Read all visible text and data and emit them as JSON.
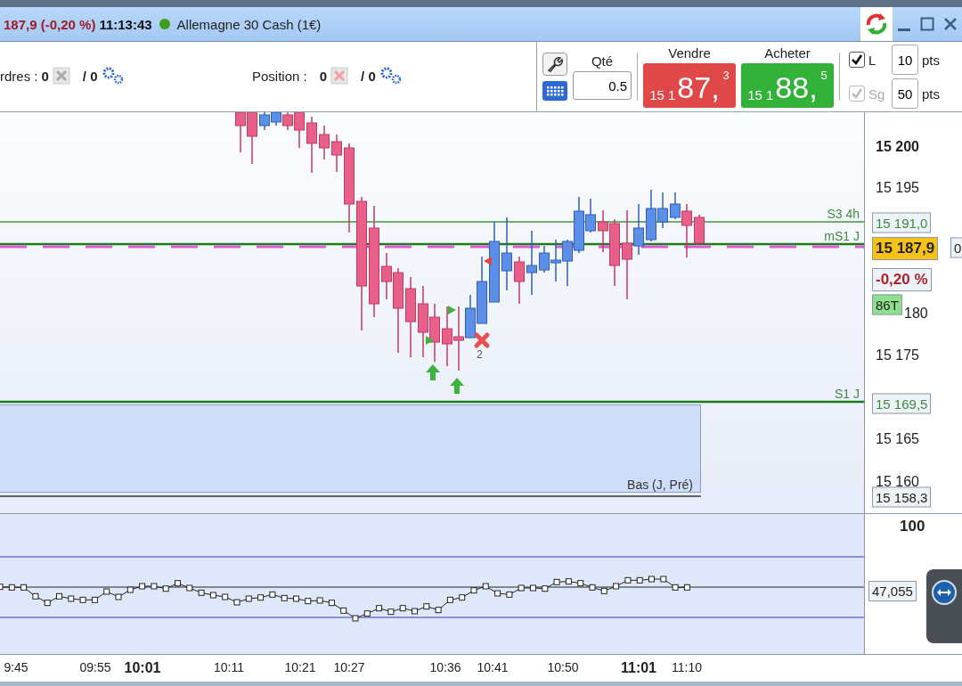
{
  "title_bar": {
    "price": "187,9 (-0,20 %)",
    "time": "11:13:43",
    "connected": true,
    "instrument": "Allemagne 30 Cash (1€)"
  },
  "toolbar": {
    "orders": {
      "label": "rdres :",
      "count": "0",
      "total": "/ 0"
    },
    "position": {
      "label": "Position :",
      "count": "0",
      "total": "/ 0"
    },
    "quantity": {
      "label": "Qté",
      "value": "0.5"
    },
    "sell": {
      "label": "Vendre",
      "prefix": "15 1",
      "main": "87,",
      "sup": "3"
    },
    "buy": {
      "label": "Acheter",
      "prefix": "15 1",
      "main": "88,",
      "sup": "5"
    },
    "stops": [
      {
        "label": "L",
        "checked": true,
        "disabled": false,
        "value": "10",
        "unit": "pts"
      },
      {
        "label": "Sg",
        "checked": true,
        "disabled": true,
        "value": "50",
        "unit": "pts"
      }
    ]
  },
  "price_chart": {
    "levels": [
      {
        "label": "S3 4h"
      },
      {
        "label": "mS1 J"
      },
      {
        "label": "S1 J"
      }
    ],
    "signal_count": "2",
    "zone_label": "Bas (J, Pré)",
    "axis_ticks": [
      {
        "label": "15 200",
        "bold": true
      },
      {
        "label": "15 195",
        "bold": false
      },
      {
        "label": "180",
        "bold": false
      },
      {
        "label": "15 175",
        "bold": false
      },
      {
        "label": "15 165",
        "bold": false
      },
      {
        "label": "15 160",
        "bold": false
      }
    ],
    "axis_labels": [
      {
        "kind": "level",
        "text": "15 191,0"
      },
      {
        "kind": "current",
        "text": "15 187,9"
      },
      {
        "kind": "plain",
        "text": "0"
      },
      {
        "kind": "change",
        "text": "-0,20 %"
      },
      {
        "kind": "volume",
        "text": "86T"
      },
      {
        "kind": "level",
        "text": "15 169,5"
      },
      {
        "kind": "plain",
        "text": "15 158,3"
      }
    ]
  },
  "oscillator": {
    "top_label": "100",
    "value": "47,055"
  },
  "time_axis": [
    {
      "label": "9:45",
      "major": false
    },
    {
      "label": "09:55",
      "major": false
    },
    {
      "label": "10:01",
      "major": true
    },
    {
      "label": "10:11",
      "major": false
    },
    {
      "label": "10:21",
      "major": false
    },
    {
      "label": "10:27",
      "major": false
    },
    {
      "label": "10:36",
      "major": false
    },
    {
      "label": "10:41",
      "major": false
    },
    {
      "label": "10:50",
      "major": false
    },
    {
      "label": "11:01",
      "major": true
    },
    {
      "label": "11:10",
      "major": false
    }
  ]
}
